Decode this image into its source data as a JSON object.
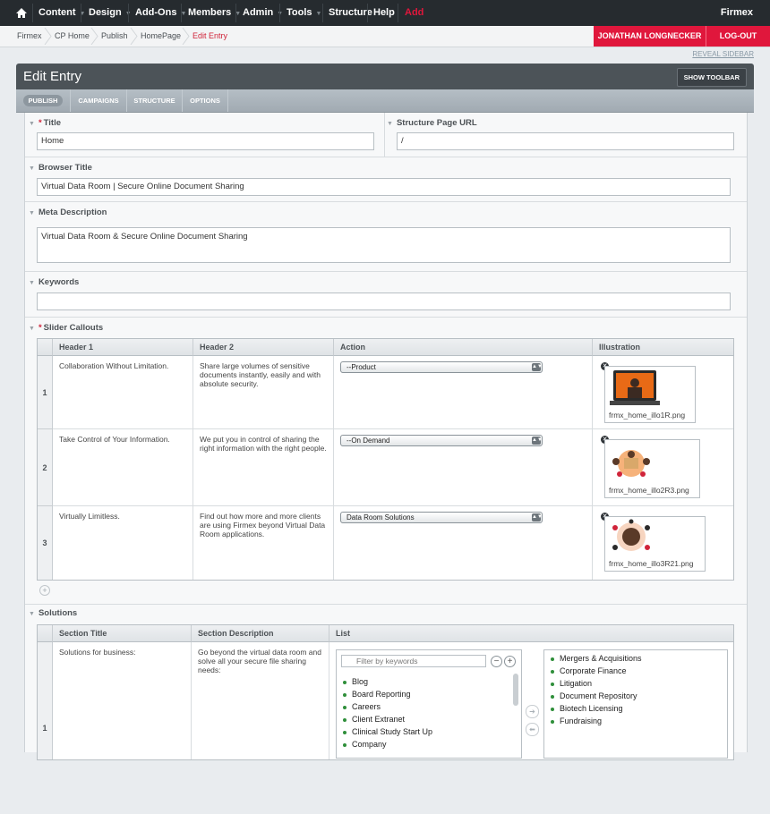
{
  "nav": {
    "items": [
      {
        "label": "Content",
        "caret": true
      },
      {
        "label": "Design",
        "caret": true
      },
      {
        "label": "Add-Ons",
        "caret": true
      },
      {
        "label": "Members",
        "caret": true
      },
      {
        "label": "Admin",
        "caret": true
      },
      {
        "label": "Tools",
        "caret": true
      },
      {
        "label": "Structure",
        "caret": false
      },
      {
        "label": "Help",
        "caret": false
      },
      {
        "label": "Add",
        "caret": false
      }
    ],
    "brand": "Firmex",
    "accent": "#e0173c"
  },
  "breadcrumb": [
    "Firmex",
    "CP Home",
    "Publish",
    "HomePage",
    "Edit Entry"
  ],
  "user": {
    "name": "JONATHAN LONGNECKER",
    "logout": "LOG-OUT"
  },
  "reveal_sidebar": "REVEAL SIDEBAR",
  "header": {
    "title": "Edit Entry",
    "show_toolbar": "SHOW TOOLBAR"
  },
  "tabs": [
    "PUBLISH",
    "CAMPAIGNS",
    "STRUCTURE",
    "OPTIONS"
  ],
  "fields": {
    "title": {
      "label": "Title",
      "value": "Home"
    },
    "structure_url": {
      "label": "Structure Page URL",
      "value": "/"
    },
    "browser_title": {
      "label": "Browser Title",
      "value": "Virtual Data Room | Secure Online Document Sharing"
    },
    "meta_description": {
      "label": "Meta Description",
      "value": "Virtual Data Room & Secure Online Document Sharing"
    },
    "keywords": {
      "label": "Keywords",
      "value": ""
    }
  },
  "slider": {
    "label": "Slider Callouts",
    "columns": [
      "Header 1",
      "Header 2",
      "Action",
      "Illustration"
    ],
    "rows": [
      {
        "num": "1",
        "h1": "Collaboration Without Limitation.",
        "h2": "Share large volumes of sensitive documents instantly, easily and with absolute security.",
        "action": "--Product",
        "file": "frmx_home_illo1R.png"
      },
      {
        "num": "2",
        "h1": "Take Control of Your Information.",
        "h2": "We put you in control of sharing the right information with the right people.",
        "action": "--On Demand",
        "file": "frmx_home_illo2R3.png"
      },
      {
        "num": "3",
        "h1": "Virtually Limitless.",
        "h2": "Find out how more and more clients are using Firmex beyond Virtual Data Room applications.",
        "action": "Data Room Solutions",
        "file": "frmx_home_illo3R21.png"
      }
    ]
  },
  "solutions": {
    "label": "Solutions",
    "columns": [
      "Section Title",
      "Section Description",
      "List"
    ],
    "row": {
      "num": "1",
      "title": "Solutions for business:",
      "description": "Go beyond the virtual data room and solve all your secure file sharing needs:",
      "filter_placeholder": "Filter by keywords",
      "available": [
        "Blog",
        "Board Reporting",
        "Careers",
        "Client Extranet",
        "Clinical Study Start Up",
        "Company"
      ],
      "selected": [
        "Mergers & Acquisitions",
        "Corporate Finance",
        "Litigation",
        "Document Repository",
        "Biotech Licensing",
        "Fundraising"
      ]
    }
  }
}
